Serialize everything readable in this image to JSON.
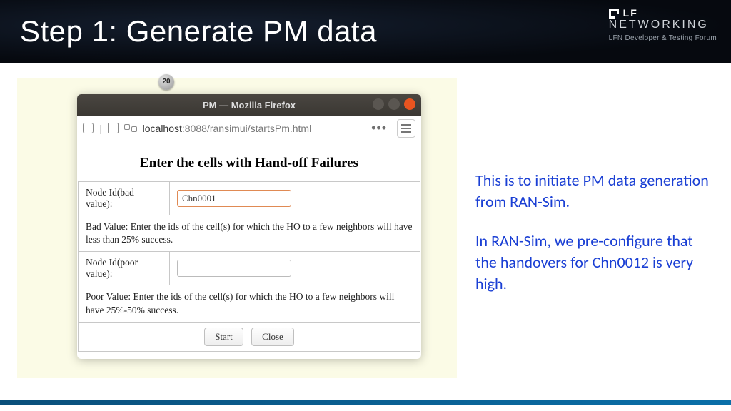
{
  "header": {
    "title": "Step 1: Generate PM data",
    "logo_lf": "LF",
    "logo_net": "NETWORKING",
    "logo_sub": "LFN Developer & Testing Forum"
  },
  "badge": "20",
  "browser": {
    "window_title": "PM — Mozilla Firefox",
    "url_host": "localhost",
    "url_path": ":8088/ransimui/startsPm.html",
    "more": "•••"
  },
  "form": {
    "heading": "Enter the cells with Hand-off Failures",
    "bad_label": "Node Id(bad value):",
    "bad_value": "Chn0001",
    "bad_desc": "Bad Value: Enter the ids of the cell(s) for which the HO to a few neighbors will have less than 25% success.",
    "poor_label": "Node Id(poor value):",
    "poor_value": "",
    "poor_desc": "Poor Value: Enter the ids of the cell(s) for which the HO to a few neighbors will have 25%-50% success.",
    "start_btn": "Start",
    "close_btn": "Close"
  },
  "notes": {
    "p1": "This is to initiate PM data generation from RAN-Sim.",
    "p2": "In RAN-Sim, we pre-configure that the handovers for Chn0012 is very high."
  }
}
